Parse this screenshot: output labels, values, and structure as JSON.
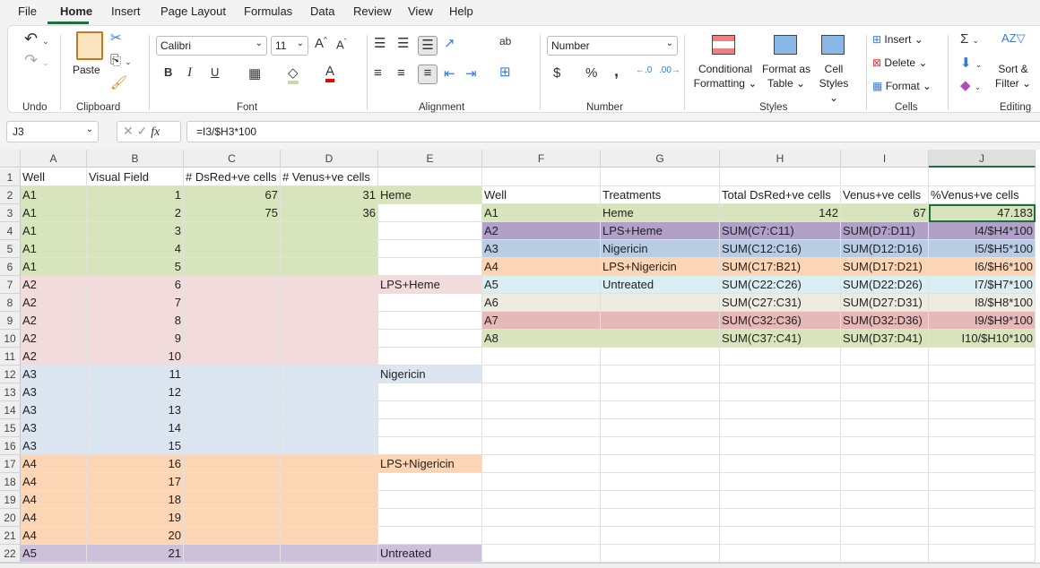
{
  "menu": {
    "items": [
      "File",
      "Home",
      "Insert",
      "Page Layout",
      "Formulas",
      "Data",
      "Review",
      "View",
      "Help"
    ],
    "active": "Home"
  },
  "ribbon": {
    "groups": {
      "undo": "Undo",
      "clipboard": "Clipboard",
      "font": "Font",
      "alignment": "Alignment",
      "number": "Number",
      "styles": "Styles",
      "cells": "Cells",
      "editing": "Editing"
    },
    "paste": "Paste",
    "font_name": "Calibri",
    "font_size": "11",
    "number_format": "Number",
    "bold": "B",
    "italic": "I",
    "underline": "U",
    "conditional_formatting": [
      "Conditional",
      "Formatting"
    ],
    "format_as_table": [
      "Format as",
      "Table"
    ],
    "cell_styles": [
      "Cell",
      "Styles"
    ],
    "insert": "Insert",
    "delete": "Delete",
    "format": "Format",
    "sort_filter": [
      "Sort &",
      "Filter"
    ],
    "currency": "$",
    "percent": "%",
    "comma": ","
  },
  "formula_bar": {
    "name_box": "J3",
    "formula": "=I3/$H3*100",
    "fx": "fx"
  },
  "columns": [
    "A",
    "B",
    "C",
    "D",
    "E",
    "F",
    "G",
    "H",
    "I",
    "J"
  ],
  "active_cell": "J3",
  "colors": {
    "green": "#d8e4bc",
    "pink": "#f2dcdb",
    "blue": "#dce6f1",
    "peach": "#fcd5b4",
    "lavender": "#ccc0da",
    "purple": "#b1a0c7",
    "steel": "#b8cce4",
    "aqua": "#daeef3",
    "beige": "#eeece1",
    "rose": "#e6b8b7"
  },
  "rows": [
    {
      "n": "1",
      "cells": [
        "Well",
        "Visual Field",
        "# DsRed+ve cells",
        "# Venus+ve cells",
        "",
        "",
        "",
        "",
        "",
        ""
      ],
      "fill": {}
    },
    {
      "n": "2",
      "cells": [
        "A1",
        "1",
        "67",
        "31",
        "Heme",
        "Well",
        "Treatments",
        "Total DsRed+ve cells",
        "Venus+ve cells",
        "%Venus+ve cells"
      ],
      "fill": {
        "A": "green",
        "B": "green",
        "C": "green",
        "D": "green",
        "E": "green"
      }
    },
    {
      "n": "3",
      "cells": [
        "A1",
        "2",
        "75",
        "36",
        "",
        "A1",
        "Heme",
        "142",
        "67",
        "47.183"
      ],
      "fill": {
        "A": "green",
        "B": "green",
        "C": "green",
        "D": "green",
        "F": "green",
        "G": "green",
        "H": "green",
        "I": "green",
        "J": "green"
      }
    },
    {
      "n": "4",
      "cells": [
        "A1",
        "3",
        "",
        "",
        "",
        "A2",
        "LPS+Heme",
        "SUM(C7:C11)",
        "SUM(D7:D11)",
        "I4/$H4*100"
      ],
      "fill": {
        "A": "green",
        "B": "green",
        "C": "green",
        "D": "green",
        "F": "purple",
        "G": "purple",
        "H": "purple",
        "I": "purple",
        "J": "purple"
      }
    },
    {
      "n": "5",
      "cells": [
        "A1",
        "4",
        "",
        "",
        "",
        "A3",
        "Nigericin",
        "SUM(C12:C16)",
        "SUM(D12:D16)",
        "I5/$H5*100"
      ],
      "fill": {
        "A": "green",
        "B": "green",
        "C": "green",
        "D": "green",
        "F": "steel",
        "G": "steel",
        "H": "steel",
        "I": "steel",
        "J": "steel"
      }
    },
    {
      "n": "6",
      "cells": [
        "A1",
        "5",
        "",
        "",
        "",
        "A4",
        "LPS+Nigericin",
        "SUM(C17:B21)",
        "SUM(D17:D21)",
        "I6/$H6*100"
      ],
      "fill": {
        "A": "green",
        "B": "green",
        "C": "green",
        "D": "green",
        "F": "peach",
        "G": "peach",
        "H": "peach",
        "I": "peach",
        "J": "peach"
      }
    },
    {
      "n": "7",
      "cells": [
        "A2",
        "6",
        "",
        "",
        "LPS+Heme",
        "A5",
        "Untreated",
        "SUM(C22:C26)",
        "SUM(D22:D26)",
        "I7/$H7*100"
      ],
      "fill": {
        "A": "pink",
        "B": "pink",
        "C": "pink",
        "D": "pink",
        "E": "pink",
        "F": "aqua",
        "G": "aqua",
        "H": "aqua",
        "I": "aqua",
        "J": "aqua"
      }
    },
    {
      "n": "8",
      "cells": [
        "A2",
        "7",
        "",
        "",
        "",
        "A6",
        "",
        "SUM(C27:C31)",
        "SUM(D27:D31)",
        "I8/$H8*100"
      ],
      "fill": {
        "A": "pink",
        "B": "pink",
        "C": "pink",
        "D": "pink",
        "F": "beige",
        "G": "beige",
        "H": "beige",
        "I": "beige",
        "J": "beige"
      }
    },
    {
      "n": "9",
      "cells": [
        "A2",
        "8",
        "",
        "",
        "",
        "A7",
        "",
        "SUM(C32:C36)",
        "SUM(D32:D36)",
        "I9/$H9*100"
      ],
      "fill": {
        "A": "pink",
        "B": "pink",
        "C": "pink",
        "D": "pink",
        "F": "rose",
        "G": "rose",
        "H": "rose",
        "I": "rose",
        "J": "rose"
      }
    },
    {
      "n": "10",
      "cells": [
        "A2",
        "9",
        "",
        "",
        "",
        "A8",
        "",
        "SUM(C37:C41)",
        "SUM(D37:D41)",
        "I10/$H10*100"
      ],
      "fill": {
        "A": "pink",
        "B": "pink",
        "C": "pink",
        "D": "pink",
        "F": "green",
        "G": "green",
        "H": "green",
        "I": "green",
        "J": "green"
      }
    },
    {
      "n": "11",
      "cells": [
        "A2",
        "10",
        "",
        "",
        "",
        "",
        "",
        "",
        "",
        ""
      ],
      "fill": {
        "A": "pink",
        "B": "pink",
        "C": "pink",
        "D": "pink"
      }
    },
    {
      "n": "12",
      "cells": [
        "A3",
        "11",
        "",
        "",
        "Nigericin",
        "",
        "",
        "",
        "",
        ""
      ],
      "fill": {
        "A": "blue",
        "B": "blue",
        "C": "blue",
        "D": "blue",
        "E": "blue"
      }
    },
    {
      "n": "13",
      "cells": [
        "A3",
        "12",
        "",
        "",
        "",
        "",
        "",
        "",
        "",
        ""
      ],
      "fill": {
        "A": "blue",
        "B": "blue",
        "C": "blue",
        "D": "blue"
      }
    },
    {
      "n": "14",
      "cells": [
        "A3",
        "13",
        "",
        "",
        "",
        "",
        "",
        "",
        "",
        ""
      ],
      "fill": {
        "A": "blue",
        "B": "blue",
        "C": "blue",
        "D": "blue"
      }
    },
    {
      "n": "15",
      "cells": [
        "A3",
        "14",
        "",
        "",
        "",
        "",
        "",
        "",
        "",
        ""
      ],
      "fill": {
        "A": "blue",
        "B": "blue",
        "C": "blue",
        "D": "blue"
      }
    },
    {
      "n": "16",
      "cells": [
        "A3",
        "15",
        "",
        "",
        "",
        "",
        "",
        "",
        "",
        ""
      ],
      "fill": {
        "A": "blue",
        "B": "blue",
        "C": "blue",
        "D": "blue"
      }
    },
    {
      "n": "17",
      "cells": [
        "A4",
        "16",
        "",
        "",
        "LPS+Nigericin",
        "",
        "",
        "",
        "",
        ""
      ],
      "fill": {
        "A": "peach",
        "B": "peach",
        "C": "peach",
        "D": "peach",
        "E": "peach"
      }
    },
    {
      "n": "18",
      "cells": [
        "A4",
        "17",
        "",
        "",
        "",
        "",
        "",
        "",
        "",
        ""
      ],
      "fill": {
        "A": "peach",
        "B": "peach",
        "C": "peach",
        "D": "peach"
      }
    },
    {
      "n": "19",
      "cells": [
        "A4",
        "18",
        "",
        "",
        "",
        "",
        "",
        "",
        "",
        ""
      ],
      "fill": {
        "A": "peach",
        "B": "peach",
        "C": "peach",
        "D": "peach"
      }
    },
    {
      "n": "20",
      "cells": [
        "A4",
        "19",
        "",
        "",
        "",
        "",
        "",
        "",
        "",
        ""
      ],
      "fill": {
        "A": "peach",
        "B": "peach",
        "C": "peach",
        "D": "peach"
      }
    },
    {
      "n": "21",
      "cells": [
        "A4",
        "20",
        "",
        "",
        "",
        "",
        "",
        "",
        "",
        ""
      ],
      "fill": {
        "A": "peach",
        "B": "peach",
        "C": "peach",
        "D": "peach"
      }
    },
    {
      "n": "22",
      "cells": [
        "A5",
        "21",
        "",
        "",
        "Untreated",
        "",
        "",
        "",
        "",
        ""
      ],
      "fill": {
        "A": "lavender",
        "B": "lavender",
        "C": "lavender",
        "D": "lavender",
        "E": "lavender"
      }
    }
  ]
}
